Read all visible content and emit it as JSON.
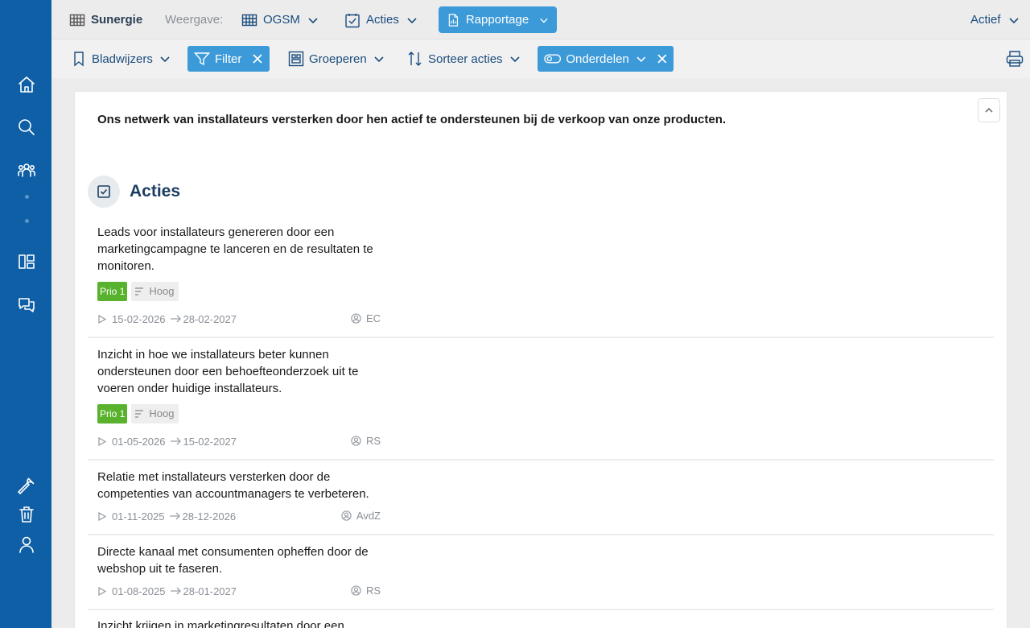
{
  "colors": {
    "sidebar": "#0f5fa6",
    "active": "#3d9ad8",
    "prio": "#58b22d",
    "text_link": "#1b4d7e"
  },
  "sidebar": {
    "icons": [
      "home-icon",
      "search-icon",
      "team-icon",
      "board-icon",
      "chat-icon",
      "wrench-icon",
      "trash-icon",
      "user-icon"
    ]
  },
  "topbar": {
    "brand": "Sunergie",
    "view_label": "Weergave:",
    "ogsm": "OGSM",
    "acties": "Acties",
    "rapportage": "Rapportage",
    "status": "Actief"
  },
  "toolbar": {
    "bookmarks": "Bladwijzers",
    "filter": "Filter",
    "group": "Groeperen",
    "sort": "Sorteer acties",
    "parts": "Onderdelen"
  },
  "main": {
    "objective": "Ons netwerk van installateurs versterken door hen actief te ondersteunen bij de verkoop van onze producten.",
    "section_title": "Acties",
    "actions": [
      {
        "text": "Leads voor installateurs genereren door een marketingcampagne te lanceren en de resultaten te monitoren.",
        "prio": "Prio 1",
        "level": "Hoog",
        "start": "15-02-2026",
        "end": "28-02-2027",
        "owner": "EC"
      },
      {
        "text": "Inzicht in hoe we installateurs beter kunnen ondersteunen door een behoefteonderzoek uit te voeren onder huidige installateurs.",
        "prio": "Prio 1",
        "level": "Hoog",
        "start": "01-05-2026",
        "end": "15-02-2027",
        "owner": "RS"
      },
      {
        "text": "Relatie met installateurs versterken door de competenties van accountmanagers te verbeteren.",
        "start": "01-11-2025",
        "end": "28-12-2026",
        "owner": "AvdZ"
      },
      {
        "text": "Directe kanaal met consumenten opheffen door de webshop uit te faseren.",
        "start": "01-08-2025",
        "end": "28-01-2027",
        "owner": "RS"
      },
      {
        "text": "Inzicht krijgen in marketingresultaten door een"
      }
    ]
  }
}
